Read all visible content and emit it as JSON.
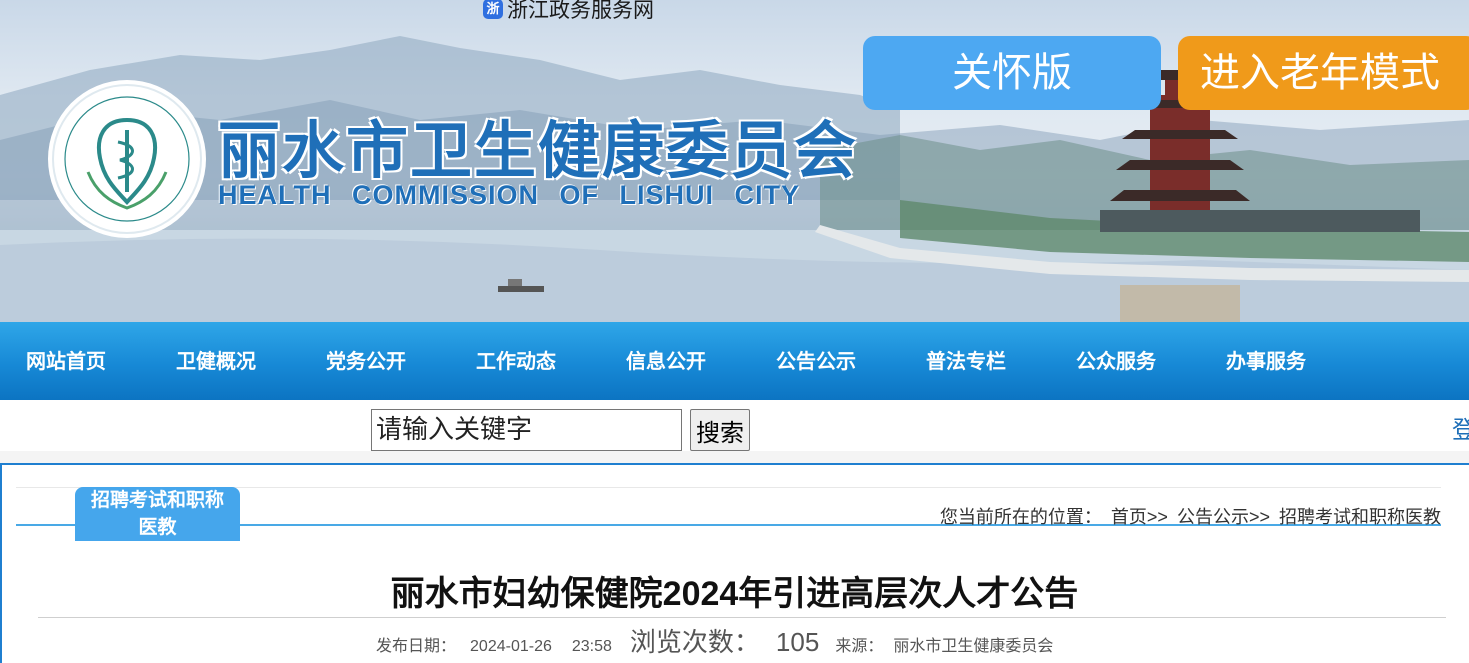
{
  "top_link": {
    "text": "浙江政务服务网",
    "icon": "zhejiang-gov-icon",
    "icon_glyph": "浙"
  },
  "banner": {
    "care_button": "关怀版",
    "elder_button": "进入老年模式",
    "site_name_cn": "丽水市卫生健康委员会",
    "site_name_en": "HEALTH COMMISSION OF LISHUI CITY",
    "colors": {
      "brand_blue": "#1f6fb8",
      "care": "#4da8f2",
      "elder": "#f09a1a"
    }
  },
  "nav": {
    "items": [
      "网站首页",
      "卫健概况",
      "党务公开",
      "工作动态",
      "信息公开",
      "公告公示",
      "普法专栏",
      "公众服务",
      "办事服务"
    ]
  },
  "search": {
    "placeholder": "请输入关键字",
    "button": "搜索",
    "login_partial": "登"
  },
  "category": {
    "tab_line1": "招聘考试和职称",
    "tab_line2": "医教"
  },
  "breadcrumb": {
    "prefix": "您当前所在的位置：",
    "items": [
      "首页>>",
      "公告公示>>",
      "招聘考试和职称医教"
    ]
  },
  "article": {
    "title": "丽水市妇幼保健院2024年引进高层次人才公告",
    "date_label": "发布日期：",
    "date": "2024-01-26",
    "time": "23:58",
    "views_label": "浏览次数：",
    "views": "105",
    "source_label": "来源：",
    "source": "丽水市卫生健康委员会"
  }
}
